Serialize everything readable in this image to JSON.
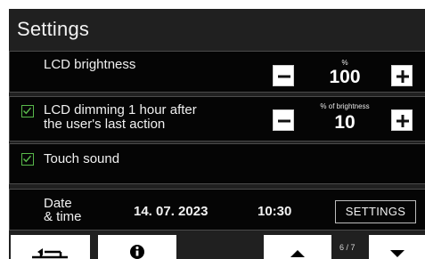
{
  "header": {
    "title": "Settings"
  },
  "lcd_brightness": {
    "label": "LCD brightness",
    "unit": "%",
    "value": "100",
    "decrease_icon": "minus-icon",
    "increase_icon": "plus-icon"
  },
  "lcd_dimming": {
    "checked": true,
    "label_line1": "LCD dimming 1 hour after",
    "label_line2": "the user's last action",
    "unit": "% of brightness",
    "value": "10",
    "decrease_icon": "minus-icon",
    "increase_icon": "plus-icon"
  },
  "touch_sound": {
    "checked": true,
    "label": "Touch sound"
  },
  "date_time": {
    "label_line1": "Date",
    "label_line2": "& time",
    "date": "14. 07. 2023",
    "time": "10:30",
    "settings_button": "SETTINGS"
  },
  "bottom_nav": {
    "back_icon": "return-arrow-icon",
    "info_icon": "info-icon",
    "up_icon": "arrow-up-icon",
    "down_icon": "arrow-down-icon",
    "page_indicator": "6 / 7"
  },
  "colors": {
    "background": "#202020",
    "row_background": "#050505",
    "checkbox_green": "#58b84a",
    "text": "#ffffff"
  }
}
